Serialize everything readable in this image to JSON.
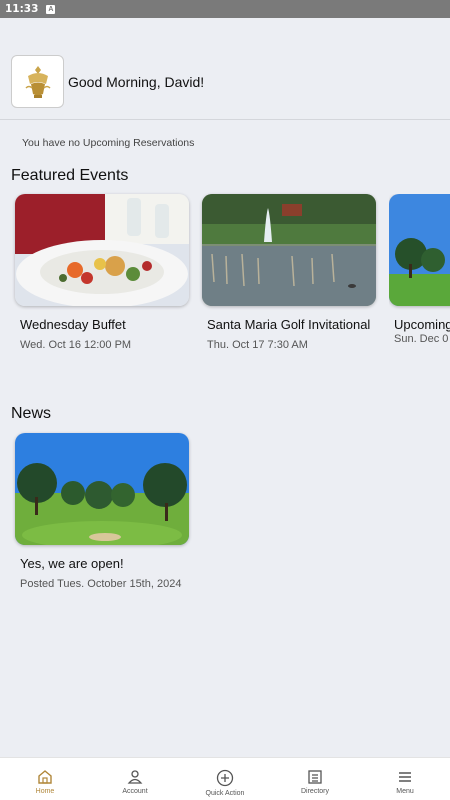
{
  "status_bar": {
    "time": "11:33",
    "indicator": "A"
  },
  "header": {
    "greeting": "Good Morning, David!",
    "logo_icon": "club-crest-logo"
  },
  "reservations": {
    "message": "You have no Upcoming Reservations"
  },
  "featured_events": {
    "title": "Featured Events",
    "items": [
      {
        "title": "Wednesday Buffet",
        "date": "Wed. Oct 16 12:00 PM",
        "image": "buffet-plate-photo"
      },
      {
        "title": "Santa Maria Golf Invitational",
        "date": "Thu. Oct 17 7:30 AM",
        "image": "fountain-pond-photo"
      },
      {
        "title": "Upcoming Title Goes",
        "date": "Sun. Dec 0",
        "image": "golf-course-photo"
      }
    ]
  },
  "news": {
    "title": "News",
    "items": [
      {
        "title": "Yes, we are open!",
        "date": "Posted Tues. October 15th, 2024",
        "image": "golf-course-photo"
      }
    ]
  },
  "bottom_nav": {
    "accent": "#b0873a",
    "items": [
      {
        "label": "Home",
        "icon": "home-icon"
      },
      {
        "label": "Account",
        "icon": "person-icon"
      },
      {
        "label": "Quick Action",
        "icon": "plus-circle-icon"
      },
      {
        "label": "Directory",
        "icon": "list-icon"
      },
      {
        "label": "Menu",
        "icon": "hamburger-icon"
      }
    ]
  }
}
